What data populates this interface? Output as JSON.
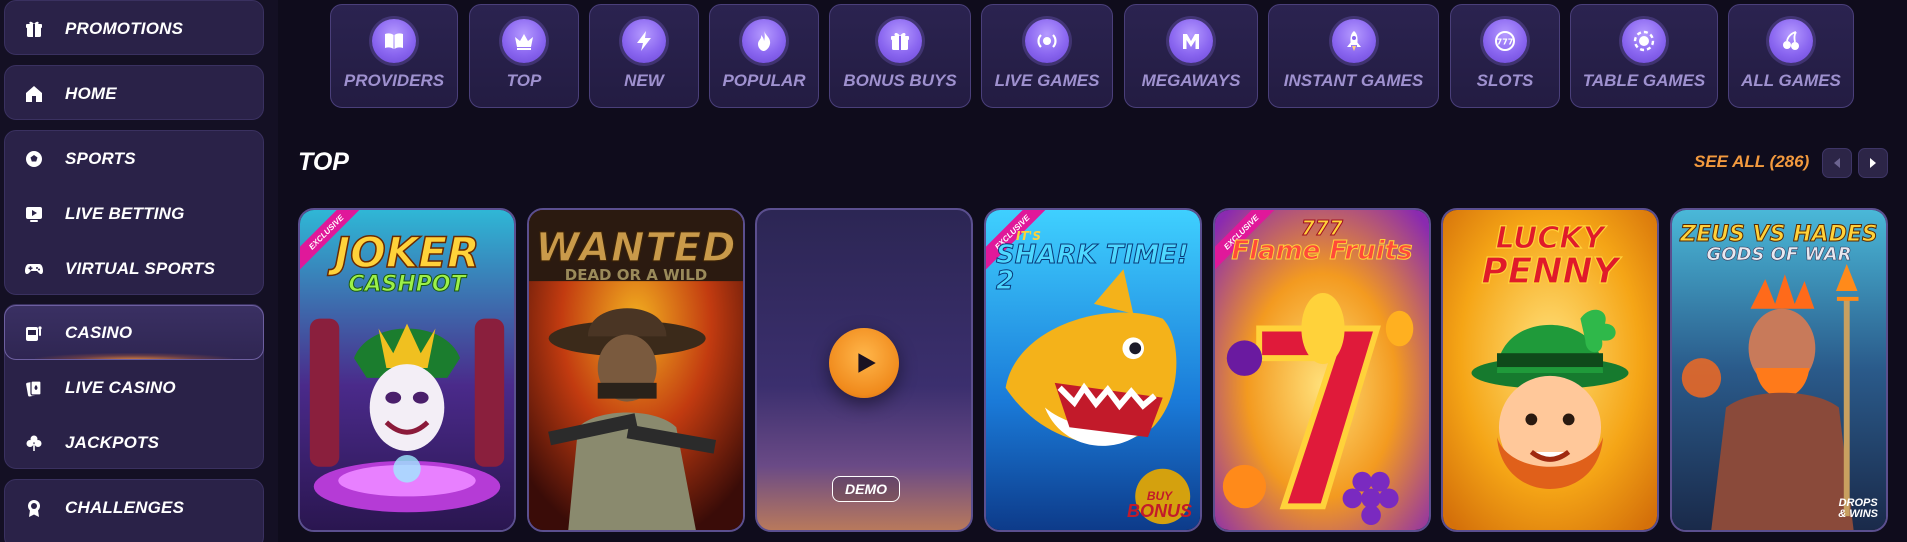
{
  "sidebar": {
    "promotions": "PROMOTIONS",
    "home": "HOME",
    "sports": "SPORTS",
    "live_betting": "LIVE BETTING",
    "virtual_sports": "VIRTUAL SPORTS",
    "casino": "CASINO",
    "live_casino": "LIVE CASINO",
    "jackpots": "JACKPOTS",
    "challenges": "CHALLENGES"
  },
  "categories": [
    {
      "label": "PROVIDERS",
      "icon": "book-icon"
    },
    {
      "label": "TOP",
      "icon": "crown-icon"
    },
    {
      "label": "NEW",
      "icon": "lightning-icon"
    },
    {
      "label": "POPULAR",
      "icon": "fire-icon"
    },
    {
      "label": "BONUS BUYS",
      "icon": "gift-icon"
    },
    {
      "label": "LIVE GAMES",
      "icon": "live-icon"
    },
    {
      "label": "MEGAWAYS",
      "icon": "megaways-icon"
    },
    {
      "label": "INSTANT GAMES",
      "icon": "rocket-icon"
    },
    {
      "label": "SLOTS",
      "icon": "slots-icon"
    },
    {
      "label": "TABLE GAMES",
      "icon": "chip-icon"
    },
    {
      "label": "ALL GAMES",
      "icon": "cherry-icon"
    }
  ],
  "section": {
    "title": "TOP",
    "see_all": "SEE ALL (286)"
  },
  "games": {
    "joker": {
      "title_line1": "JOKER",
      "title_line2": "CASHPOT",
      "badge": "EXCLUSIVE"
    },
    "wanted": {
      "title_line1": "WANTED",
      "title_line2": "DEAD OR A WILD"
    },
    "demo": {
      "button": "DEMO"
    },
    "shark": {
      "title_line1": "IT'S",
      "title_line2": "SHARK TIME! 2",
      "badge": "EXCLUSIVE",
      "corner_line1": "BUY",
      "corner_line2": "BONUS"
    },
    "flame": {
      "title_line1": "777",
      "title_line2": "Flame Fruits",
      "badge": "EXCLUSIVE"
    },
    "lucky": {
      "title_line1": "LUCKY",
      "title_line2": "PENNY"
    },
    "zeus": {
      "title_line1": "ZEUS VS HADES",
      "title_line2": "GODS OF WAR",
      "corner_line1": "DROPS",
      "corner_line2": "& WINS"
    }
  },
  "colors": {
    "accent_orange": "#f39a3e",
    "sidebar_bg": "#141024",
    "page_bg": "#0f0c1c",
    "category_icon": "#8a66f0"
  }
}
